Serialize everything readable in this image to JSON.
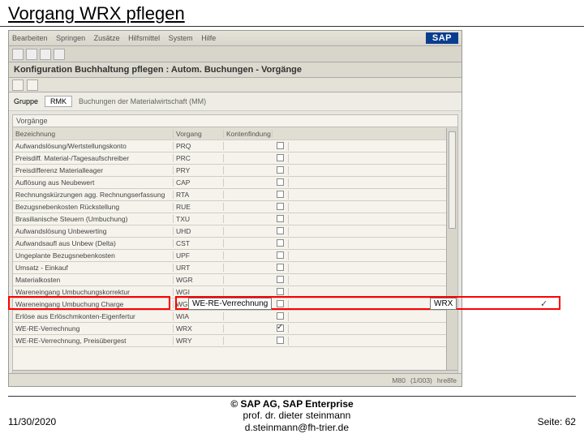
{
  "slide": {
    "title": "Vorgang WRX pflegen"
  },
  "menubar": {
    "items": [
      "Bearbeiten",
      "Springen",
      "Zusätze",
      "Hilfsmittel",
      "System",
      "Hilfe"
    ]
  },
  "logo": "SAP",
  "screen": {
    "title": "Konfiguration Buchhaltung pflegen : Autom. Buchungen - Vorgänge"
  },
  "gruppe": {
    "label": "Gruppe",
    "code": "RMK",
    "desc": "Buchungen der Materialwirtschaft (MM)"
  },
  "table": {
    "caption": "Vorgänge",
    "headers": {
      "desc": "Bezeichnung",
      "code": "Vorgang",
      "kf": "Kontenfindung"
    },
    "rows": [
      {
        "desc": "Aufwandslösung/Wertstellungskonto",
        "code": "PRQ",
        "chk": false
      },
      {
        "desc": "Preisdiff. Material-/Tagesaufschreiber",
        "code": "PRC",
        "chk": false
      },
      {
        "desc": "Preisdifferenz Materialleager",
        "code": "PRY",
        "chk": false
      },
      {
        "desc": "Auflösung aus Neubewert",
        "code": "CAP",
        "chk": false
      },
      {
        "desc": "Rechnungskürzungen agg. Rechnungserfassung",
        "code": "RTA",
        "chk": false
      },
      {
        "desc": "Bezugsnebenkosten Rückstellung",
        "code": "RUE",
        "chk": false
      },
      {
        "desc": "Brasilianische Steuern (Umbuchung)",
        "code": "TXU",
        "chk": false
      },
      {
        "desc": "Aufwandslösung Unbewerting",
        "code": "UHD",
        "chk": false
      },
      {
        "desc": "Aufwandsaufl aus Unbew (Delta)",
        "code": "CST",
        "chk": false
      },
      {
        "desc": "Ungeplante Bezugsnebenkosten",
        "code": "UPF",
        "chk": false
      },
      {
        "desc": "Umsatz - Einkauf",
        "code": "URT",
        "chk": false
      },
      {
        "desc": "Materialkosten",
        "code": "WGR",
        "chk": false
      },
      {
        "desc": "Wareneingang Umbuchungskorrektur",
        "code": "WGI",
        "chk": false
      },
      {
        "desc": "Wareneingang Umbuchung Charge",
        "code": "WGR",
        "chk": false
      },
      {
        "desc": "Erlöse aus Erlöschmkonten-Eigenfertur",
        "code": "WIA",
        "chk": false
      },
      {
        "desc": "WE-RE-Verrechnung",
        "code": "WRX",
        "chk": true
      },
      {
        "desc": "WE-RE-Verrechnung, Preisübergest",
        "code": "WRY",
        "chk": false
      }
    ]
  },
  "highlight": {
    "text": "WE-RE-Verrechnung",
    "code": "WRX"
  },
  "statusbar": {
    "client": "M80",
    "sys": "(1/003)",
    "srv": "hre8fe"
  },
  "footer": {
    "copyright": "© SAP AG, SAP Enterprise",
    "date": "11/30/2020",
    "author_line1": "prof. dr. dieter steinmann",
    "author_line2": "d.steinmann@fh-trier.de",
    "page": "Seite: 62"
  }
}
